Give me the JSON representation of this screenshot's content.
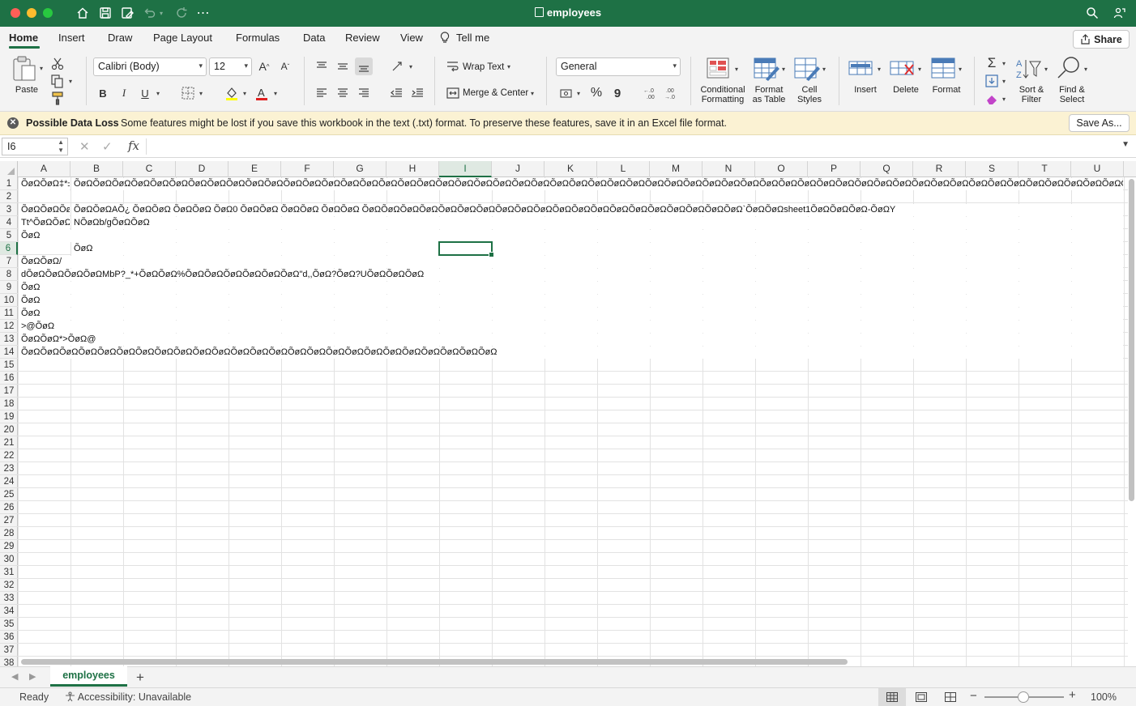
{
  "app": {
    "doc_title": "employees",
    "theme_color": "#1e7145"
  },
  "titlebar_icons": [
    "home-icon",
    "save-icon",
    "save-as-icon",
    "undo-icon",
    "redo-icon",
    "more-icon",
    "search-icon",
    "collaborate-icon"
  ],
  "ribbon_tabs": [
    "Home",
    "Insert",
    "Draw",
    "Page Layout",
    "Formulas",
    "Data",
    "Review",
    "View"
  ],
  "tell_me": "Tell me",
  "share_label": "Share",
  "ribbon": {
    "paste": "Paste",
    "font_name": "Calibri (Body)",
    "font_size": "12",
    "bold": "B",
    "italic": "I",
    "underline": "U",
    "wrap_text": "Wrap Text",
    "merge_center": "Merge & Center",
    "number_format": "General",
    "percent": "%",
    "comma": "9",
    "conditional_formatting": [
      "Conditional",
      "Formatting"
    ],
    "format_as_table": [
      "Format",
      "as Table"
    ],
    "cell_styles": [
      "Cell",
      "Styles"
    ],
    "insert": "Insert",
    "delete": "Delete",
    "format": "Format",
    "sort_filter": [
      "Sort &",
      "Filter"
    ],
    "find_select": [
      "Find &",
      "Select"
    ]
  },
  "infobar": {
    "title": "Possible Data Loss",
    "message": "Some features might be lost if you save this workbook in the text (.txt) format. To preserve these features, save it in an Excel file format.",
    "button": "Save As..."
  },
  "formula_bar": {
    "name_box": "I6",
    "fx": "fx",
    "content": ""
  },
  "grid": {
    "columns": [
      "A",
      "B",
      "C",
      "D",
      "E",
      "F",
      "G",
      "H",
      "I",
      "J",
      "K",
      "L",
      "M",
      "N",
      "O",
      "P",
      "Q",
      "R",
      "S",
      "T",
      "U"
    ],
    "selected_column": "I",
    "selected_row": 6,
    "selected_cell": "I6",
    "row_count": 38,
    "cells": [
      {
        "ref": "A1",
        "row": 1,
        "col": "A",
        "text": "ÕøΩÕøΩ‡*±("
      },
      {
        "ref": "B1",
        "row": 1,
        "col": "B",
        "text": "ÕøΩÕøΩÕøΩÕøΩÕøΩÕøΩÕøΩÕøΩÕøΩÕøΩÕøΩÕøΩÕøΩÕøΩÕøΩÕøΩÕøΩÕøΩÕøΩÕøΩÕøΩÕøΩÕøΩÕøΩÕøΩÕøΩÕøΩÕøΩÕøΩÕøΩÕøΩÕøΩÕøΩÕøΩÕøΩÕøΩÕøΩÕøΩÕøΩÕøΩÕøΩÕøΩÕøΩÕøΩÕøΩÕøΩÕøΩÕøΩÕøΩÕøΩÕøΩÕøΩÕøΩÕøΩÕøΩÕøΩÕøΩÕøΩÕøΩÕøΩ"
      },
      {
        "ref": "A3",
        "row": 3,
        "col": "A",
        "text": "ÕøΩÕøΩÕøΩÕøΩ"
      },
      {
        "ref": "B3",
        "row": 3,
        "col": "B",
        "text": "ÕøΩÕøΩAÕ¿ ÕøΩÕøΩ ÕøΩÕøΩ ÕøΩ0 ÕøΩÕøΩ ÕøΩÕøΩ ÕøΩÕøΩ ÕøΩÕøΩÕøΩÕøΩÕøΩÕøΩÕøΩÕøΩÕøΩÕøΩÕøΩÕøΩÕøΩÕøΩÕøΩÕøΩÕøΩÕøΩÕøΩÕøΩ`ÕøΩÕøΩsheet1ÕøΩÕøΩÕøΩ-ÕøΩY"
      },
      {
        "ref": "A4",
        "row": 4,
        "col": "A",
        "text": "Tt^ÕøΩÕøΩ("
      },
      {
        "ref": "B4",
        "row": 4,
        "col": "B",
        "text": "NÕøΩb/gÕøΩÕøΩ"
      },
      {
        "ref": "A5",
        "row": 5,
        "col": "A",
        "text": "ÕøΩ"
      },
      {
        "ref": "B6",
        "row": 6,
        "col": "B",
        "text": "ÕøΩ"
      },
      {
        "ref": "A7",
        "row": 7,
        "col": "A",
        "text": "ÕøΩÕøΩ/"
      },
      {
        "ref": "A8",
        "row": 8,
        "col": "A",
        "text": "dÕøΩÕøΩÕøΩÕøΩMbP?_*+ÕøΩÕøΩ%ÕøΩÕøΩÕøΩÕøΩÕøΩÕøΩ\"d,,ÕøΩ?ÕøΩ?UÕøΩÕøΩÕøΩ"
      },
      {
        "ref": "A9",
        "row": 9,
        "col": "A",
        "text": "ÕøΩ"
      },
      {
        "ref": "A10",
        "row": 10,
        "col": "A",
        "text": "ÕøΩ"
      },
      {
        "ref": "A11",
        "row": 11,
        "col": "A",
        "text": "ÕøΩ"
      },
      {
        "ref": "A12",
        "row": 12,
        "col": "A",
        "text": ">@ÕøΩ"
      },
      {
        "ref": "A13",
        "row": 13,
        "col": "A",
        "text": "ÕøΩÕøΩ*>ÕøΩ@"
      },
      {
        "ref": "A14",
        "row": 14,
        "col": "A",
        "text": "ÕøΩÕøΩÕøΩÕøΩÕøΩÕøΩÕøΩÕøΩÕøΩÕøΩÕøΩÕøΩÕøΩÕøΩÕøΩÕøΩÕøΩÕøΩÕøΩÕøΩÕøΩÕøΩÕøΩÕøΩÕøΩ"
      }
    ]
  },
  "sheet_tabs": [
    "employees"
  ],
  "add_sheet": "+",
  "status": {
    "ready": "Ready",
    "accessibility": "Accessibility: Unavailable",
    "zoom": "100%"
  }
}
